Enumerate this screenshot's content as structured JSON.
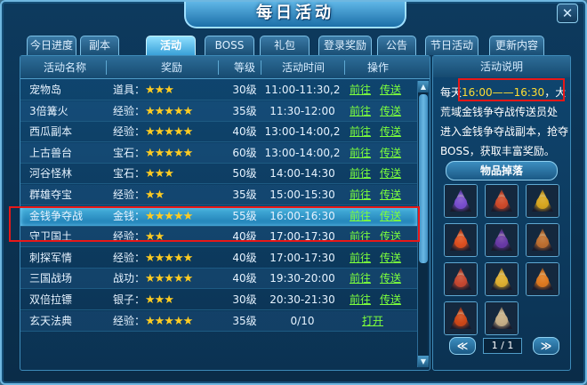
{
  "window": {
    "title": "每日活动",
    "close_label": "✕"
  },
  "tabs": [
    {
      "label": "今日进度"
    },
    {
      "label": "副本"
    },
    {
      "label": "活动"
    },
    {
      "label": "BOSS"
    },
    {
      "label": "礼包"
    },
    {
      "label": "登录奖励"
    },
    {
      "label": "公告"
    },
    {
      "label": "节日活动"
    },
    {
      "label": "更新内容"
    }
  ],
  "active_tab": "活动",
  "table": {
    "headers": [
      "活动名称",
      "奖励",
      "等级",
      "活动时间",
      "操作"
    ],
    "rows": [
      {
        "name": "宠物岛",
        "reward_type": "道具：",
        "stars": "★★★",
        "level": "30级",
        "time": "11:00-11:30,2",
        "go": "前往",
        "teleport": "传送"
      },
      {
        "name": "3倍篝火",
        "reward_type": "经验：",
        "stars": "★★★★★",
        "level": "35级",
        "time": "11:30-12:00",
        "go": "前往",
        "teleport": "传送"
      },
      {
        "name": "西瓜副本",
        "reward_type": "经验：",
        "stars": "★★★★★",
        "level": "40级",
        "time": "13:00-14:00,2",
        "go": "前往",
        "teleport": "传送"
      },
      {
        "name": "上古兽台",
        "reward_type": "宝石：",
        "stars": "★★★★★",
        "level": "60级",
        "time": "13:00-14:00,2",
        "go": "前往",
        "teleport": "传送"
      },
      {
        "name": "河谷怪林",
        "reward_type": "宝石：",
        "stars": "★★★",
        "level": "50级",
        "time": "14:00-14:30",
        "go": "前往",
        "teleport": "传送"
      },
      {
        "name": "群雄夺宝",
        "reward_type": "经验：",
        "stars": "★★",
        "level": "35级",
        "time": "15:00-15:30",
        "go": "前往",
        "teleport": "传送"
      },
      {
        "name": "金钱争夺战",
        "reward_type": "金钱：",
        "stars": "★★★★★",
        "level": "55级",
        "time": "16:00-16:30",
        "go": "前往",
        "teleport": "传送",
        "selected": true
      },
      {
        "name": "守卫国土",
        "reward_type": "经验：",
        "stars": "★★",
        "level": "40级",
        "time": "17:00-17:30",
        "go": "前往",
        "teleport": "传送"
      },
      {
        "name": "刺探军情",
        "reward_type": "经验：",
        "stars": "★★★★★",
        "level": "40级",
        "time": "17:00-17:30",
        "go": "前往",
        "teleport": "传送"
      },
      {
        "name": "三国战场",
        "reward_type": "战功：",
        "stars": "★★★★★",
        "level": "40级",
        "time": "19:30-20:00",
        "go": "前往",
        "teleport": "传送"
      },
      {
        "name": "双倍拉镖",
        "reward_type": "银子：",
        "stars": "★★★",
        "level": "30级",
        "time": "20:30-21:30",
        "go": "前往",
        "teleport": "传送"
      },
      {
        "name": "玄天法典",
        "reward_type": "经验：",
        "stars": "★★★★★",
        "level": "35级",
        "time": "0/10",
        "open": "打开"
      }
    ]
  },
  "side": {
    "header": "活动说明",
    "desc_prefix": "每天",
    "desc_time": "16:00——16:30",
    "desc_line1_tail": "，大荒",
    "desc_rest": "域金钱争夺战传送员处进入金钱争夺战副本，抢夺BOSS，获取丰富奖励。",
    "drops_header": "物品掉落",
    "items": [
      {
        "icon": "purple-scroll-icon",
        "color": "#7a4fd0"
      },
      {
        "icon": "red-envelope-icon",
        "color": "#d04a2a"
      },
      {
        "icon": "gold-shield-icon",
        "color": "#d9a820"
      },
      {
        "icon": "fire-axe-icon",
        "color": "#e05020"
      },
      {
        "icon": "dark-dagger-icon",
        "color": "#6a3aa8"
      },
      {
        "icon": "hammer-icon",
        "color": "#c07030"
      },
      {
        "icon": "feather-red-icon",
        "color": "#c84830"
      },
      {
        "icon": "gold-feather-icon",
        "color": "#e0b030"
      },
      {
        "icon": "sun-orb-icon",
        "color": "#e07a20"
      },
      {
        "icon": "fire-orb-icon",
        "color": "#d04818"
      },
      {
        "icon": "paper-scroll-icon",
        "color": "#c8b088"
      }
    ],
    "pager_prev": "≪",
    "pager_next": "≫",
    "pager_text": "1 / 1"
  }
}
